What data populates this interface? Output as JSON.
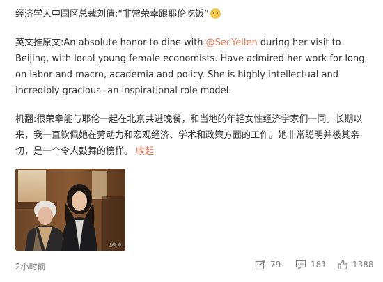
{
  "post": {
    "headline": "经济学人中国区总裁刘倩:“非常荣幸跟耶伦吃饭”",
    "headline_emoji": "smiling-face-emoji",
    "original_prefix": "英文推原文:",
    "original_before_mention": "An absolute honor to dine with ",
    "mention": "@SecYellen",
    "original_after_mention": " during her visit to Beijing, with local young female economists. Have admired her work for long, on labor and macro, academia and policy. She is highly intellectual and incredibly gracious--an inspirational role model.",
    "translation": "机翻:很荣幸能与耶伦一起在北京共进晚餐，和当地的年轻女性经济学家们一同。长期以来，我一直钦佩她在劳动力和宏观经济、学术和政策方面的工作。她非常聪明并极其亲切，是一个令人鼓舞的榜样。",
    "collapse_label": "收起",
    "photo_watermark": "@微博",
    "timestamp": "2小时前"
  },
  "actions": {
    "share_count": "79",
    "comment_count": "181",
    "like_count": "1388"
  },
  "colors": {
    "text": "#333333",
    "accent": "#eb7350",
    "meta": "#808080"
  }
}
